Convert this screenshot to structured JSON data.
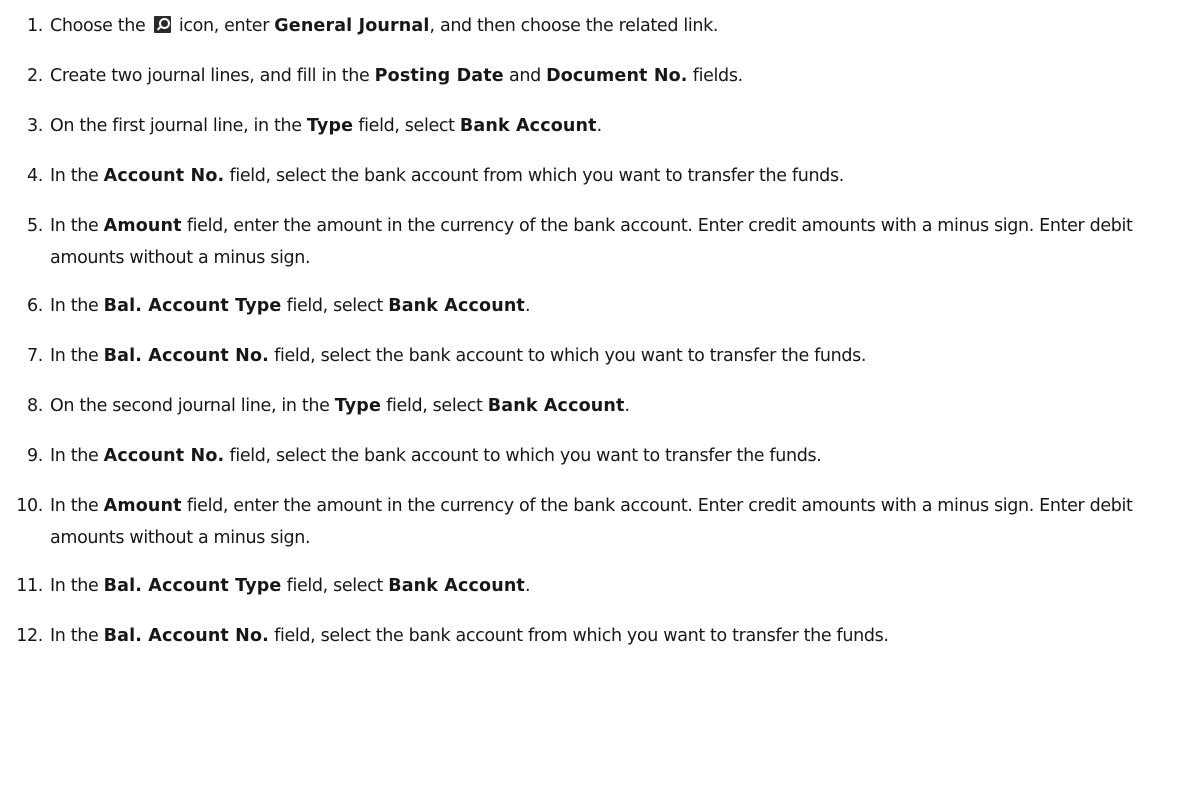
{
  "steps": [
    {
      "num": "1.",
      "parts": [
        {
          "t": "Choose the "
        },
        {
          "icon": "search-icon"
        },
        {
          "t": " icon, enter "
        },
        {
          "t": "General Journal",
          "b": true
        },
        {
          "t": ", and then choose the related link."
        }
      ]
    },
    {
      "num": "2.",
      "parts": [
        {
          "t": "Create two journal lines, and fill in the "
        },
        {
          "t": "Posting Date",
          "b": true
        },
        {
          "t": " and "
        },
        {
          "t": "Document No.",
          "b": true
        },
        {
          "t": " fields."
        }
      ]
    },
    {
      "num": "3.",
      "parts": [
        {
          "t": "On the first journal line, in the "
        },
        {
          "t": "Type",
          "b": true
        },
        {
          "t": " field, select "
        },
        {
          "t": "Bank Account",
          "b": true
        },
        {
          "t": "."
        }
      ]
    },
    {
      "num": "4.",
      "parts": [
        {
          "t": "In the "
        },
        {
          "t": "Account No.",
          "b": true
        },
        {
          "t": " field, select the bank account from which you want to transfer the funds."
        }
      ]
    },
    {
      "num": "5.",
      "twoLine": true,
      "parts": [
        {
          "t": "In the "
        },
        {
          "t": "Amount",
          "b": true
        },
        {
          "t": " field, enter the amount in the currency of the bank account. Enter credit amounts with a minus sign. Enter debit amounts without a minus sign."
        }
      ]
    },
    {
      "num": "6.",
      "parts": [
        {
          "t": "In the "
        },
        {
          "t": "Bal. Account Type",
          "b": true
        },
        {
          "t": " field, select "
        },
        {
          "t": "Bank Account",
          "b": true
        },
        {
          "t": "."
        }
      ]
    },
    {
      "num": "7.",
      "parts": [
        {
          "t": "In the "
        },
        {
          "t": "Bal. Account No.",
          "b": true
        },
        {
          "t": " field, select the bank account to which you want to transfer the funds."
        }
      ]
    },
    {
      "num": "8.",
      "parts": [
        {
          "t": "On the second journal line, in the "
        },
        {
          "t": "Type",
          "b": true
        },
        {
          "t": " field, select "
        },
        {
          "t": "Bank Account",
          "b": true
        },
        {
          "t": "."
        }
      ]
    },
    {
      "num": "9.",
      "parts": [
        {
          "t": "In the "
        },
        {
          "t": "Account No.",
          "b": true
        },
        {
          "t": " field, select the bank account to which you want to transfer the funds."
        }
      ]
    },
    {
      "num": "10.",
      "twoLine": true,
      "parts": [
        {
          "t": "In the "
        },
        {
          "t": "Amount",
          "b": true
        },
        {
          "t": " field, enter the amount in the currency of the bank account. Enter credit amounts with a minus sign. Enter debit amounts without a minus sign."
        }
      ]
    },
    {
      "num": "11.",
      "parts": [
        {
          "t": "In the "
        },
        {
          "t": "Bal. Account Type",
          "b": true
        },
        {
          "t": " field, select "
        },
        {
          "t": "Bank Account",
          "b": true
        },
        {
          "t": "."
        }
      ]
    },
    {
      "num": "12.",
      "parts": [
        {
          "t": "In the "
        },
        {
          "t": "Bal. Account No.",
          "b": true
        },
        {
          "t": " field, select the bank account from which you want to transfer the funds."
        }
      ]
    }
  ]
}
